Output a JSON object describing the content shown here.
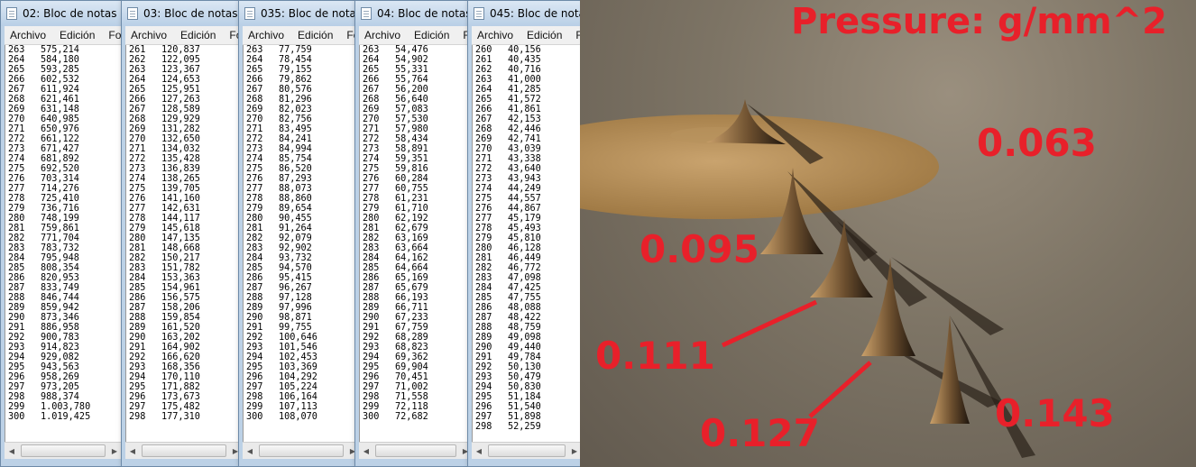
{
  "windows": [
    {
      "title": "02: Bloc de notas",
      "menu": [
        "Archivo",
        "Edición",
        "Fo"
      ],
      "rows": [
        [
          "263",
          "575,214"
        ],
        [
          "264",
          "584,180"
        ],
        [
          "265",
          "593,285"
        ],
        [
          "266",
          "602,532"
        ],
        [
          "267",
          "611,924"
        ],
        [
          "268",
          "621,461"
        ],
        [
          "269",
          "631,148"
        ],
        [
          "270",
          "640,985"
        ],
        [
          "271",
          "650,976"
        ],
        [
          "272",
          "661,122"
        ],
        [
          "273",
          "671,427"
        ],
        [
          "274",
          "681,892"
        ],
        [
          "275",
          "692,520"
        ],
        [
          "276",
          "703,314"
        ],
        [
          "277",
          "714,276"
        ],
        [
          "278",
          "725,410"
        ],
        [
          "279",
          "736,716"
        ],
        [
          "280",
          "748,199"
        ],
        [
          "281",
          "759,861"
        ],
        [
          "282",
          "771,704"
        ],
        [
          "283",
          "783,732"
        ],
        [
          "284",
          "795,948"
        ],
        [
          "285",
          "808,354"
        ],
        [
          "286",
          "820,953"
        ],
        [
          "287",
          "833,749"
        ],
        [
          "288",
          "846,744"
        ],
        [
          "289",
          "859,942"
        ],
        [
          "290",
          "873,346"
        ],
        [
          "291",
          "886,958"
        ],
        [
          "292",
          "900,783"
        ],
        [
          "293",
          "914,823"
        ],
        [
          "294",
          "929,082"
        ],
        [
          "295",
          "943,563"
        ],
        [
          "296",
          "958,269"
        ],
        [
          "297",
          "973,205"
        ],
        [
          "298",
          "988,374"
        ],
        [
          "299",
          "1.003,780"
        ],
        [
          "300",
          "1.019,425"
        ]
      ]
    },
    {
      "title": "03: Bloc de notas",
      "menu": [
        "Archivo",
        "Edición",
        "Fo"
      ],
      "rows": [
        [
          "261",
          "120,837"
        ],
        [
          "262",
          "122,095"
        ],
        [
          "263",
          "123,367"
        ],
        [
          "264",
          "124,653"
        ],
        [
          "265",
          "125,951"
        ],
        [
          "266",
          "127,263"
        ],
        [
          "267",
          "128,589"
        ],
        [
          "268",
          "129,929"
        ],
        [
          "269",
          "131,282"
        ],
        [
          "270",
          "132,650"
        ],
        [
          "271",
          "134,032"
        ],
        [
          "272",
          "135,428"
        ],
        [
          "273",
          "136,839"
        ],
        [
          "274",
          "138,265"
        ],
        [
          "275",
          "139,705"
        ],
        [
          "276",
          "141,160"
        ],
        [
          "277",
          "142,631"
        ],
        [
          "278",
          "144,117"
        ],
        [
          "279",
          "145,618"
        ],
        [
          "280",
          "147,135"
        ],
        [
          "281",
          "148,668"
        ],
        [
          "282",
          "150,217"
        ],
        [
          "283",
          "151,782"
        ],
        [
          "284",
          "153,363"
        ],
        [
          "285",
          "154,961"
        ],
        [
          "286",
          "156,575"
        ],
        [
          "287",
          "158,206"
        ],
        [
          "288",
          "159,854"
        ],
        [
          "289",
          "161,520"
        ],
        [
          "290",
          "163,202"
        ],
        [
          "291",
          "164,902"
        ],
        [
          "292",
          "166,620"
        ],
        [
          "293",
          "168,356"
        ],
        [
          "294",
          "170,110"
        ],
        [
          "295",
          "171,882"
        ],
        [
          "296",
          "173,673"
        ],
        [
          "297",
          "175,482"
        ],
        [
          "298",
          "177,310"
        ]
      ]
    },
    {
      "title": "035: Bloc de notas",
      "menu": [
        "Archivo",
        "Edición",
        "Fo"
      ],
      "rows": [
        [
          "263",
          "77,759"
        ],
        [
          "264",
          "78,454"
        ],
        [
          "265",
          "79,155"
        ],
        [
          "266",
          "79,862"
        ],
        [
          "267",
          "80,576"
        ],
        [
          "268",
          "81,296"
        ],
        [
          "269",
          "82,023"
        ],
        [
          "270",
          "82,756"
        ],
        [
          "271",
          "83,495"
        ],
        [
          "272",
          "84,241"
        ],
        [
          "273",
          "84,994"
        ],
        [
          "274",
          "85,754"
        ],
        [
          "275",
          "86,520"
        ],
        [
          "276",
          "87,293"
        ],
        [
          "277",
          "88,073"
        ],
        [
          "278",
          "88,860"
        ],
        [
          "279",
          "89,654"
        ],
        [
          "280",
          "90,455"
        ],
        [
          "281",
          "91,264"
        ],
        [
          "282",
          "92,079"
        ],
        [
          "283",
          "92,902"
        ],
        [
          "284",
          "93,732"
        ],
        [
          "285",
          "94,570"
        ],
        [
          "286",
          "95,415"
        ],
        [
          "287",
          "96,267"
        ],
        [
          "288",
          "97,128"
        ],
        [
          "289",
          "97,996"
        ],
        [
          "290",
          "98,871"
        ],
        [
          "291",
          "99,755"
        ],
        [
          "292",
          "100,646"
        ],
        [
          "293",
          "101,546"
        ],
        [
          "294",
          "102,453"
        ],
        [
          "295",
          "103,369"
        ],
        [
          "296",
          "104,292"
        ],
        [
          "297",
          "105,224"
        ],
        [
          "298",
          "106,164"
        ],
        [
          "299",
          "107,113"
        ],
        [
          "300",
          "108,070"
        ]
      ]
    },
    {
      "title": "04: Bloc de notas",
      "menu": [
        "Archivo",
        "Edición",
        "Fo"
      ],
      "rows": [
        [
          "263",
          "54,476"
        ],
        [
          "264",
          "54,902"
        ],
        [
          "265",
          "55,331"
        ],
        [
          "266",
          "55,764"
        ],
        [
          "267",
          "56,200"
        ],
        [
          "268",
          "56,640"
        ],
        [
          "269",
          "57,083"
        ],
        [
          "270",
          "57,530"
        ],
        [
          "271",
          "57,980"
        ],
        [
          "272",
          "58,434"
        ],
        [
          "273",
          "58,891"
        ],
        [
          "274",
          "59,351"
        ],
        [
          "275",
          "59,816"
        ],
        [
          "276",
          "60,284"
        ],
        [
          "277",
          "60,755"
        ],
        [
          "278",
          "61,231"
        ],
        [
          "279",
          "61,710"
        ],
        [
          "280",
          "62,192"
        ],
        [
          "281",
          "62,679"
        ],
        [
          "282",
          "63,169"
        ],
        [
          "283",
          "63,664"
        ],
        [
          "284",
          "64,162"
        ],
        [
          "285",
          "64,664"
        ],
        [
          "286",
          "65,169"
        ],
        [
          "287",
          "65,679"
        ],
        [
          "288",
          "66,193"
        ],
        [
          "289",
          "66,711"
        ],
        [
          "290",
          "67,233"
        ],
        [
          "291",
          "67,759"
        ],
        [
          "292",
          "68,289"
        ],
        [
          "293",
          "68,823"
        ],
        [
          "294",
          "69,362"
        ],
        [
          "295",
          "69,904"
        ],
        [
          "296",
          "70,451"
        ],
        [
          "297",
          "71,002"
        ],
        [
          "298",
          "71,558"
        ],
        [
          "299",
          "72,118"
        ],
        [
          "300",
          "72,682"
        ]
      ]
    },
    {
      "title": "045: Bloc de notas",
      "menu": [
        "Archivo",
        "Edición",
        "Fo"
      ],
      "rows": [
        [
          "260",
          "40,156"
        ],
        [
          "261",
          "40,435"
        ],
        [
          "262",
          "40,716"
        ],
        [
          "263",
          "41,000"
        ],
        [
          "264",
          "41,285"
        ],
        [
          "265",
          "41,572"
        ],
        [
          "266",
          "41,861"
        ],
        [
          "267",
          "42,153"
        ],
        [
          "268",
          "42,446"
        ],
        [
          "269",
          "42,741"
        ],
        [
          "270",
          "43,039"
        ],
        [
          "271",
          "43,338"
        ],
        [
          "272",
          "43,640"
        ],
        [
          "273",
          "43,943"
        ],
        [
          "274",
          "44,249"
        ],
        [
          "275",
          "44,557"
        ],
        [
          "276",
          "44,867"
        ],
        [
          "277",
          "45,179"
        ],
        [
          "278",
          "45,493"
        ],
        [
          "279",
          "45,810"
        ],
        [
          "280",
          "46,128"
        ],
        [
          "281",
          "46,449"
        ],
        [
          "282",
          "46,772"
        ],
        [
          "283",
          "47,098"
        ],
        [
          "284",
          "47,425"
        ],
        [
          "285",
          "47,755"
        ],
        [
          "286",
          "48,088"
        ],
        [
          "287",
          "48,422"
        ],
        [
          "288",
          "48,759"
        ],
        [
          "289",
          "49,098"
        ],
        [
          "290",
          "49,440"
        ],
        [
          "291",
          "49,784"
        ],
        [
          "292",
          "50,130"
        ],
        [
          "293",
          "50,479"
        ],
        [
          "294",
          "50,830"
        ],
        [
          "295",
          "51,184"
        ],
        [
          "296",
          "51,540"
        ],
        [
          "297",
          "51,898"
        ],
        [
          "298",
          "52,259"
        ]
      ]
    }
  ],
  "scene": {
    "heading": "Pressure:  g/mm^2",
    "values": [
      "0.063",
      "0.095",
      "0.111",
      "0.127",
      "0.143"
    ],
    "label_color": "#e8202a"
  }
}
